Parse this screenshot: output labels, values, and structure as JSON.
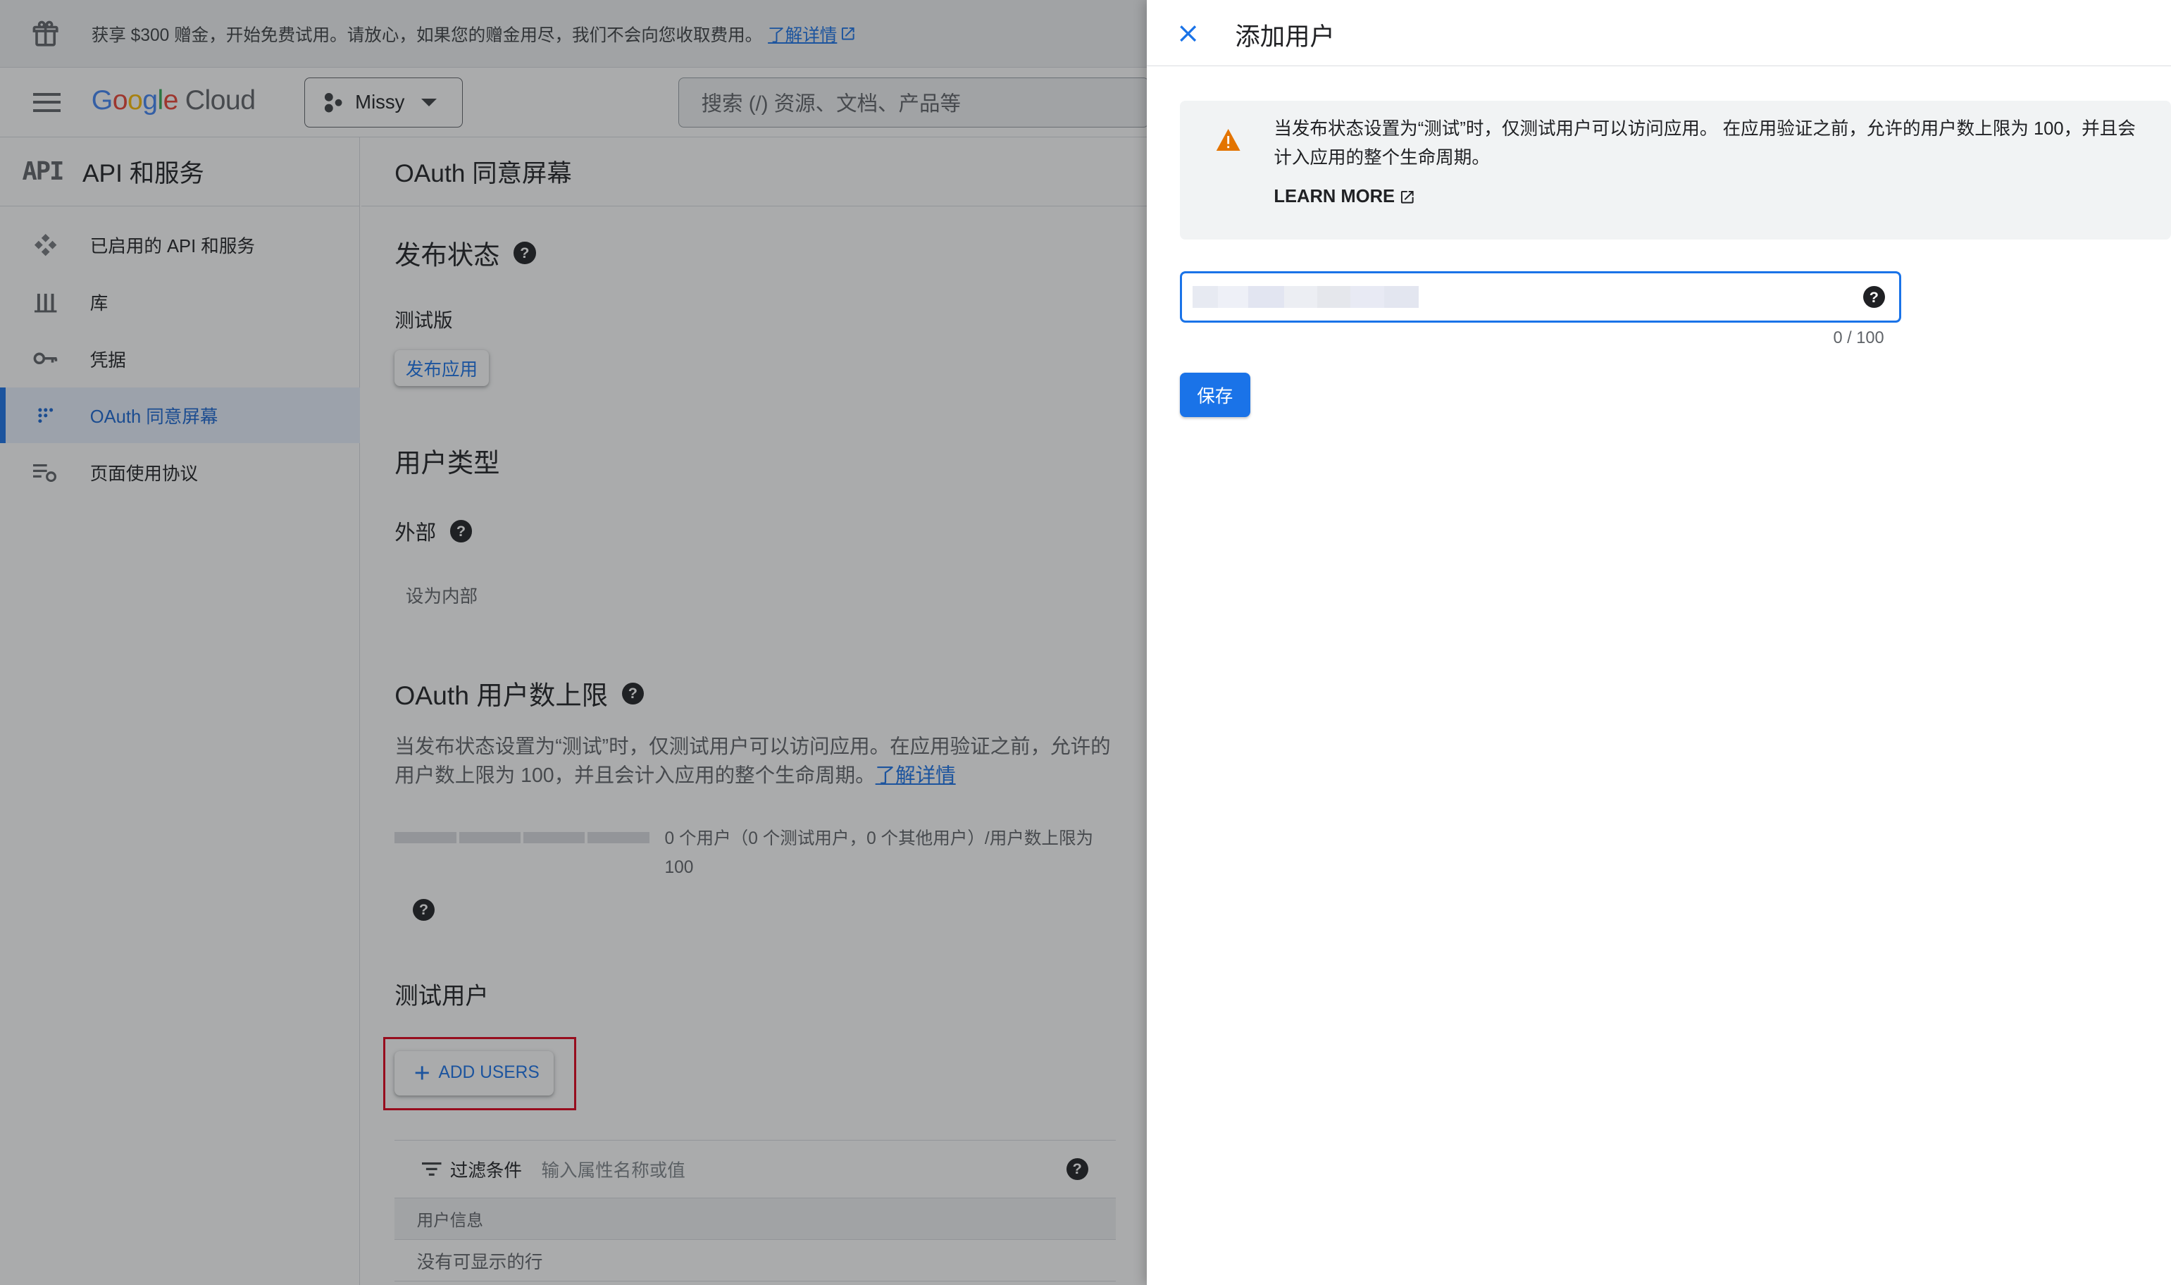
{
  "banner": {
    "text": "获享 $300 赠金，开始免费试用。请放心，如果您的赠金用尽，我们不会向您收取费用。",
    "link": "了解详情"
  },
  "header": {
    "logo_parts": [
      "G",
      "o",
      "o",
      "g",
      "l",
      "e"
    ],
    "logo_suffix": "Cloud",
    "project": "Missy",
    "search_placeholder": "搜索 (/) 资源、文档、产品等"
  },
  "leftnav": {
    "section_logo": "API",
    "section_title": "API 和服务",
    "items": [
      {
        "label": "已启用的 API 和服务",
        "icon": "api-diamond-icon"
      },
      {
        "label": "库",
        "icon": "library-icon"
      },
      {
        "label": "凭据",
        "icon": "key-icon"
      },
      {
        "label": "OAuth 同意屏幕",
        "icon": "consent-grid-icon"
      },
      {
        "label": "页面使用协议",
        "icon": "settings-list-icon"
      }
    ]
  },
  "main": {
    "title": "OAuth 同意屏幕",
    "publish_status": {
      "heading": "发布状态",
      "state": "测试版",
      "publish_button": "发布应用"
    },
    "user_type": {
      "heading": "用户类型",
      "value": "外部",
      "make_internal": "设为内部"
    },
    "user_cap": {
      "heading": "OAuth 用户数上限",
      "description": "当发布状态设置为“测试”时，仅测试用户可以访问应用。在应用验证之前，允许的用户数上限为 100，并且会计入应用的整个生命周期。",
      "link": "了解详情",
      "progress_label": "0 个用户（0 个测试用户，0 个其他用户）/用户数上限为 100",
      "progress_value": 0
    },
    "test_users": {
      "heading": "测试用户",
      "add_button": "ADD USERS",
      "filter_label": "过滤条件",
      "filter_placeholder": "输入属性名称或值",
      "column_header": "用户信息",
      "empty_text": "没有可显示的行"
    }
  },
  "drawer": {
    "title": "添加用户",
    "warning": "当发布状态设置为“测试”时，仅测试用户可以访问应用。 在应用验证之前，允许的用户数上限为 100，并且会计入应用的整个生命周期。",
    "learn_more": "LEARN MORE",
    "input_value": "",
    "counter": "0 / 100",
    "save_button": "保存"
  },
  "colors": {
    "accent": "#1a73e8",
    "warning": "#e37400",
    "highlight": "#e0001b"
  }
}
